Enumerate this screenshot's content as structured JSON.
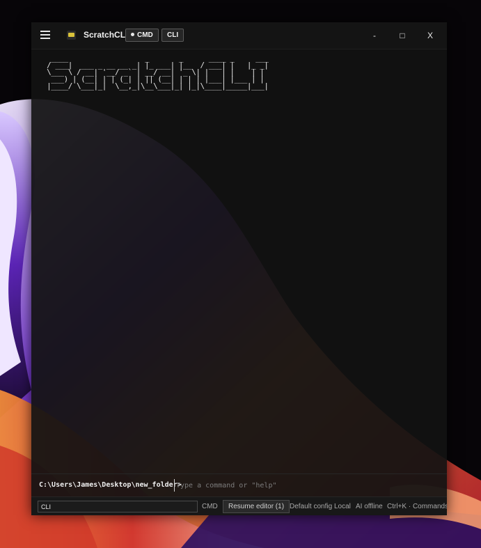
{
  "app": {
    "title": "ScratchCLI",
    "mode_badges": [
      "CMD",
      "CLI"
    ],
    "window_controls": {
      "minimize": "-",
      "maximize": "□",
      "close": "X"
    }
  },
  "banner": {
    "ascii_art": "  ____                  _       _      ____ _     ___ \n / ___|  ___ _ __ __ _| |_ ___| |__  / ___| |   |_ _|\n \\___ \\ / __| '__/ _` | __/ __| '_ \\| |   | |    | | \n  ___) | (__| | | (_| | || (__| | | | |___| |___ | | \n |____/ \\___|_|  \\__,_|\\__\\___|_| |_|\\____|_____|___|"
  },
  "prompt": {
    "path": "C:\\Users\\James\\Desktop\\new_folder>",
    "placeholder": "Type a command or \"help\""
  },
  "statusbar": {
    "mode_value": "CLI",
    "cmd_label": "CMD",
    "resume_label": "Resume editor (1)",
    "config_label": "Default config",
    "location_label": "Local",
    "ai_status": "AI offline",
    "commands_hint": "Ctrl+K · Commands"
  },
  "icons": [
    "hamburger-menu-icon",
    "app-logo-icon",
    "active-dot-icon"
  ],
  "colors": {
    "window_bg": "#121212",
    "titlebar_bg": "#141414",
    "text_primary": "#f0f0f0",
    "text_muted": "#a8a8a8",
    "wallpaper_accent_purple": "#6b2fd0",
    "wallpaper_accent_orange": "#e0773a",
    "wallpaper_accent_red": "#c0262e"
  }
}
